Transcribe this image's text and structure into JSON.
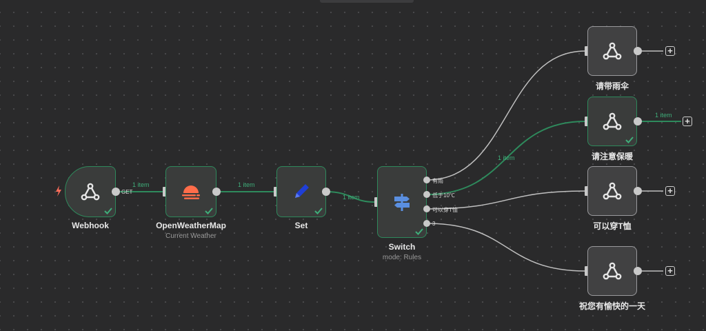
{
  "colors": {
    "canvas": "#2a2a2b",
    "node_border_success": "#2e8a5c",
    "edge_success": "#2e8a5c",
    "edge_default": "#c0c0c0",
    "accent_trigger": "#ff6d5a",
    "switch_icon": "#5a8fe0",
    "set_icon": "#1f3fd6",
    "weather_icon": "#ff6d4a"
  },
  "nodes": {
    "webhook": {
      "title": "Webhook",
      "method": "GET",
      "icon": "webhook-icon",
      "status": "success"
    },
    "openweathermap": {
      "title": "OpenWeatherMap",
      "subtitle": "Current Weather",
      "icon": "sun-icon",
      "status": "success"
    },
    "set": {
      "title": "Set",
      "icon": "pencil-icon",
      "status": "success"
    },
    "switch": {
      "title": "Switch",
      "subtitle": "mode: Rules",
      "icon": "signpost-icon",
      "status": "success",
      "outputs": [
        "有雨",
        "低于10℃",
        "可以穿T恤",
        "3"
      ]
    },
    "umbrella": {
      "title": "请带雨伞",
      "icon": "webhook-icon",
      "status": "idle"
    },
    "warm": {
      "title": "请注意保暖",
      "icon": "webhook-icon",
      "status": "success"
    },
    "tshirt": {
      "title": "可以穿T恤",
      "icon": "webhook-icon",
      "status": "idle"
    },
    "happy": {
      "title": "祝您有愉快的一天",
      "icon": "webhook-icon",
      "status": "idle"
    }
  },
  "edges": {
    "webhook_to_weather": "1 item",
    "weather_to_set": "1 item",
    "set_to_switch": "1 item",
    "switch_to_warm": "1 item",
    "warm_out": "1 item"
  }
}
